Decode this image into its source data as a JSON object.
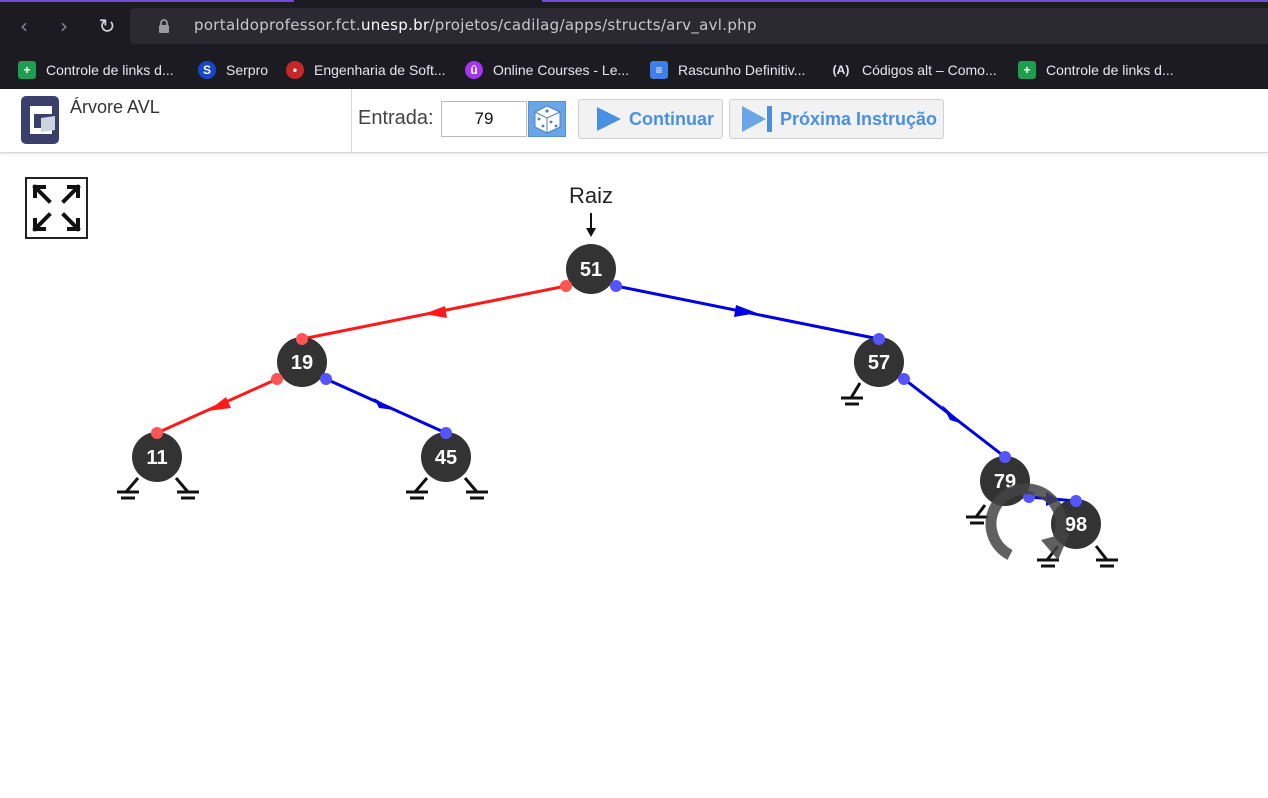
{
  "browser": {
    "url_prefix": "portaldoprofessor.fct.",
    "url_domain": "unesp.br",
    "url_path": "/projetos/cadilag/apps/structs/arv_avl.php",
    "bookmarks": [
      {
        "label": "Controle de links d...",
        "icon": "google-sheets-icon",
        "color": "#1e9e4f"
      },
      {
        "label": "Serpro",
        "icon": "serpro-icon",
        "color": "#1747c9"
      },
      {
        "label": "Engenharia de Soft...",
        "icon": "ladybug-icon",
        "color": "#c62828"
      },
      {
        "label": "Online Courses - Le...",
        "icon": "udemy-icon",
        "color": "#a435f0"
      },
      {
        "label": "Rascunho Definitiv...",
        "icon": "google-docs-icon",
        "color": "#3f7ee8"
      },
      {
        "label": "Códigos alt – Como...",
        "icon": "code-icon",
        "color": "#1c1b22"
      },
      {
        "label": "Controle de links d...",
        "icon": "google-sheets-icon",
        "color": "#1e9e4f"
      }
    ]
  },
  "app": {
    "title": "Árvore AVL",
    "entrada_label": "Entrada:",
    "entrada_value": "79",
    "continue_label": "Continuar",
    "next_label": "Próxima Instrução"
  },
  "tree": {
    "root_label": "Raiz",
    "nodes": [
      "51",
      "19",
      "57",
      "11",
      "45",
      "79",
      "98"
    ],
    "colors": {
      "left_edge": "#ff1a1a",
      "right_edge": "#0000e6",
      "node": "#333333"
    }
  }
}
